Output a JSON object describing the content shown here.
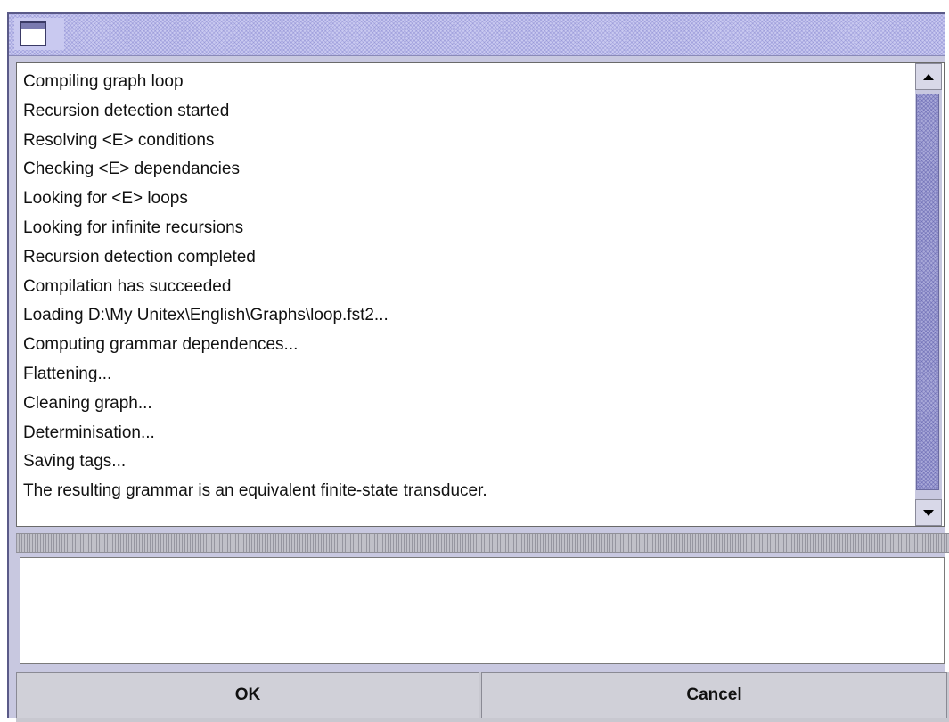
{
  "window": {
    "title": ""
  },
  "log": {
    "lines": [
      "Compiling graph loop",
      "Recursion detection started",
      "Resolving <E> conditions",
      "Checking <E> dependancies",
      "Looking for <E> loops",
      "Looking for infinite recursions",
      "Recursion detection completed",
      "Compilation has succeeded",
      "Loading D:\\My Unitex\\English\\Graphs\\loop.fst2...",
      "Computing grammar dependences...",
      "Flattening...",
      "Cleaning graph...",
      "Determinisation...",
      "Saving tags...",
      "The resulting grammar is an equivalent finite-state transducer."
    ]
  },
  "input_pane": {
    "value": ""
  },
  "buttons": {
    "ok_label": "OK",
    "cancel_label": "Cancel"
  },
  "icons": {
    "title": "window-icon",
    "scroll_up": "arrow-up-icon",
    "scroll_down": "arrow-down-icon"
  },
  "colors": {
    "title_bar": "#c9c9f0",
    "scroll_thumb": "#a8a8d8",
    "button_face": "#d0d0d8"
  }
}
